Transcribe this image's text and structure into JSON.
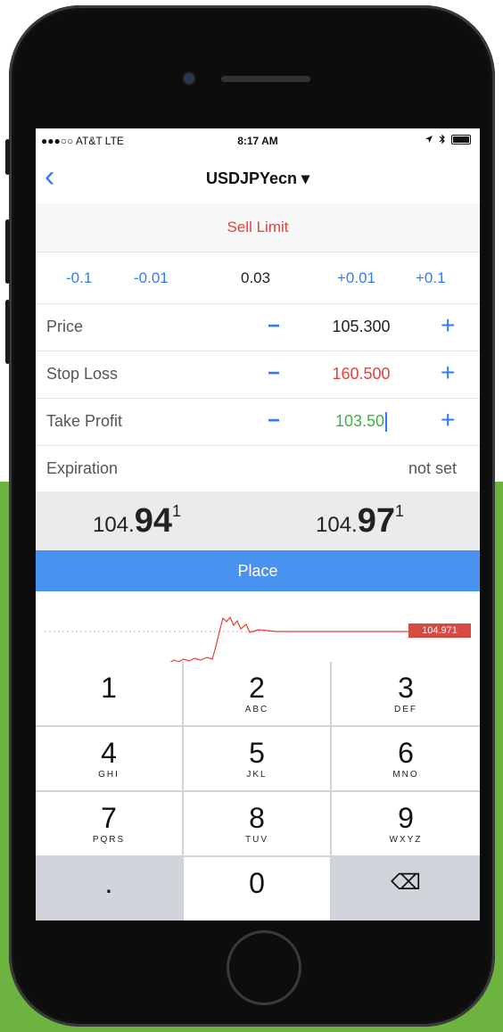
{
  "status_bar": {
    "carrier": "●●●○○ AT&T  LTE",
    "time": "8:17 AM",
    "icons": [
      "location-icon",
      "bluetooth-icon",
      "battery-icon"
    ]
  },
  "nav": {
    "back_icon": "chevron-left-icon",
    "title": "USDJPYecn ▾"
  },
  "order_type": "Sell Limit",
  "volume": {
    "minus_big": "-0.1",
    "minus_small": "-0.01",
    "value": "0.03",
    "plus_small": "+0.01",
    "plus_big": "+0.1"
  },
  "fields": [
    {
      "label": "Price",
      "minus": "−",
      "value": "105.300",
      "plus": "+"
    },
    {
      "label": "Stop Loss",
      "minus": "−",
      "value": "160.500",
      "plus": "+"
    },
    {
      "label": "Take Profit",
      "minus": "−",
      "value": "103.50",
      "plus": "+"
    }
  ],
  "expiration": {
    "label": "Expiration",
    "value": "not set"
  },
  "quotes": {
    "bid": {
      "lead": "104.",
      "big": "94",
      "sup": "1"
    },
    "ask": {
      "lead": "104.",
      "big": "97",
      "sup": "1"
    }
  },
  "place_label": "Place",
  "chart": {
    "last_price": "104.971",
    "line_color": "#e6403a"
  },
  "keypad": [
    {
      "num": "1",
      "letters": ""
    },
    {
      "num": "2",
      "letters": "ABC"
    },
    {
      "num": "3",
      "letters": "DEF"
    },
    {
      "num": "4",
      "letters": "GHI"
    },
    {
      "num": "5",
      "letters": "JKL"
    },
    {
      "num": "6",
      "letters": "MNO"
    },
    {
      "num": "7",
      "letters": "PQRS"
    },
    {
      "num": "8",
      "letters": "TUV"
    },
    {
      "num": "9",
      "letters": "WXYZ"
    },
    {
      "num": ".",
      "letters": ""
    },
    {
      "num": "0",
      "letters": ""
    },
    {
      "num": "⌫",
      "letters": ""
    }
  ],
  "colors": {
    "accent": "#2f7cf6",
    "sell": "#e6403a",
    "take_profit": "#3cb043",
    "place": "#4a92f0"
  }
}
